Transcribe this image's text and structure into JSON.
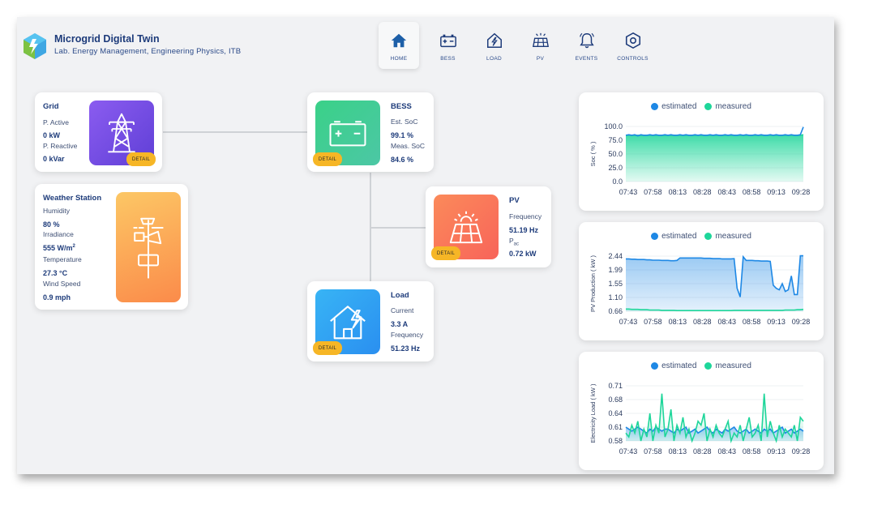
{
  "app": {
    "title": "Microgrid Digital Twin",
    "subtitle": "Lab. Energy Management, Engineering Physics, ITB"
  },
  "nav": [
    {
      "label": "HOME",
      "icon": "home-icon"
    },
    {
      "label": "BESS",
      "icon": "battery-icon"
    },
    {
      "label": "LOAD",
      "icon": "house-bolt-icon"
    },
    {
      "label": "PV",
      "icon": "solar-panel-icon"
    },
    {
      "label": "EVENTS",
      "icon": "bell-icon"
    },
    {
      "label": "CONTROLS",
      "icon": "hexagon-gear-icon"
    }
  ],
  "grid": {
    "title": "Grid",
    "p_active_label": "P. Active",
    "p_active_value": "0 kW",
    "p_reactive_label": "P. Reactive",
    "p_reactive_value": "0 kVar",
    "detail": "DETAIL"
  },
  "weather": {
    "title": "Weather Station",
    "humidity_label": "Humidity",
    "humidity_value": "80 %",
    "irradiance_label": "Irradiance",
    "irradiance_value": "555 W/m",
    "irradiance_sup": "2",
    "temperature_label": "Temperature",
    "temperature_value": "27.3 °C",
    "wind_label": "Wind Speed",
    "wind_value": "0.9 mph"
  },
  "bess": {
    "title": "BESS",
    "est_soc_label": "Est. SoC",
    "est_soc_value": "99.1 %",
    "meas_soc_label": "Meas. SoC",
    "meas_soc_value": "84.6 %",
    "detail": "DETAIL"
  },
  "pv": {
    "title": "PV",
    "freq_label": "Frequency",
    "freq_value": "51.19 Hz",
    "pac_label": "P",
    "pac_sub": "ac",
    "pac_value": "0.72 kW",
    "detail": "DETAIL"
  },
  "load": {
    "title": "Load",
    "current_label": "Current",
    "current_value": "3.3 A",
    "freq_label": "Frequency",
    "freq_value": "51.23 Hz",
    "detail": "DETAIL"
  },
  "colors": {
    "estimated": "#1e88e5",
    "measured": "#1ed69a",
    "detail": "#f6b626",
    "grid_tile": "#7a4be0",
    "weather_tile": "#fb9a52",
    "bess_tile": "#3ccf8e",
    "pv_tile": "#fa6f5a",
    "load_tile": "#2d9df0"
  },
  "chart_data": [
    {
      "type": "line",
      "legend": [
        "estimated",
        "measured"
      ],
      "ylabel": "Soc ( % )",
      "x_ticks": [
        "07:43",
        "07:58",
        "08:13",
        "08:28",
        "08:43",
        "08:58",
        "09:13",
        "09:28"
      ],
      "y_ticks": [
        "100.0",
        "75.0",
        "50.0",
        "25.0",
        "0.0"
      ],
      "ylim": [
        0,
        100
      ],
      "series": [
        {
          "name": "estimated",
          "values": [
            84,
            85,
            84,
            85,
            83,
            85,
            84,
            84,
            85,
            84,
            85,
            84,
            84,
            85,
            84,
            85,
            84,
            84,
            85,
            84,
            85,
            84,
            84,
            85,
            84,
            85,
            84,
            84,
            85,
            84,
            85,
            84,
            84,
            85,
            84,
            85,
            84,
            84,
            85,
            84,
            85,
            84,
            84,
            85,
            84,
            85,
            84,
            84,
            85,
            84,
            85,
            84,
            84,
            85,
            84,
            85,
            84,
            84,
            85,
            99
          ]
        },
        {
          "name": "measured",
          "values": [
            84,
            84,
            84,
            84,
            84,
            84,
            84,
            84,
            84,
            84,
            84,
            84,
            84,
            84,
            84,
            84,
            84,
            84,
            84,
            84,
            84,
            84,
            84,
            84,
            84,
            84,
            84,
            84,
            84,
            84,
            84,
            84,
            84,
            84,
            84,
            84,
            84,
            84,
            84,
            84,
            84,
            84,
            84,
            84,
            84,
            84,
            84,
            84,
            84,
            84,
            84,
            84,
            84,
            84,
            84,
            84,
            84,
            84,
            84,
            85
          ]
        }
      ]
    },
    {
      "type": "line",
      "legend": [
        "estimated",
        "measured"
      ],
      "ylabel": "PV Production ( kW )",
      "x_ticks": [
        "07:43",
        "07:58",
        "08:13",
        "08:28",
        "08:43",
        "08:58",
        "09:13",
        "09:28"
      ],
      "y_ticks": [
        "2.44",
        "1.99",
        "1.55",
        "1.10",
        "0.66"
      ],
      "ylim": [
        0.66,
        2.44
      ],
      "series": [
        {
          "name": "estimated",
          "values": [
            2.35,
            2.35,
            2.34,
            2.34,
            2.33,
            2.33,
            2.33,
            2.32,
            2.32,
            2.31,
            2.31,
            2.31,
            2.3,
            2.3,
            2.3,
            2.29,
            2.29,
            2.3,
            2.38,
            2.38,
            2.38,
            2.38,
            2.38,
            2.38,
            2.38,
            2.38,
            2.37,
            2.37,
            2.37,
            2.36,
            2.36,
            2.36,
            2.35,
            2.35,
            2.35,
            2.35,
            2.36,
            1.4,
            1.12,
            2.42,
            2.3,
            2.3,
            2.3,
            2.29,
            2.29,
            2.28,
            2.28,
            2.28,
            2.27,
            1.5,
            1.4,
            1.35,
            1.55,
            1.3,
            1.35,
            1.8,
            1.2,
            1.2,
            2.45,
            2.45
          ]
        },
        {
          "name": "measured",
          "values": [
            0.73,
            0.73,
            0.72,
            0.72,
            0.72,
            0.71,
            0.71,
            0.71,
            0.7,
            0.7,
            0.7,
            0.7,
            0.69,
            0.69,
            0.69,
            0.69,
            0.69,
            0.68,
            0.68,
            0.68,
            0.68,
            0.68,
            0.68,
            0.68,
            0.68,
            0.68,
            0.68,
            0.68,
            0.68,
            0.68,
            0.68,
            0.68,
            0.68,
            0.68,
            0.68,
            0.68,
            0.69,
            0.69,
            0.69,
            0.69,
            0.69,
            0.69,
            0.69,
            0.69,
            0.69,
            0.69,
            0.69,
            0.69,
            0.69,
            0.69,
            0.69,
            0.69,
            0.69,
            0.7,
            0.7,
            0.7,
            0.7,
            0.71,
            0.71,
            0.72
          ]
        }
      ]
    },
    {
      "type": "line",
      "legend": [
        "estimated",
        "measured"
      ],
      "ylabel": "Electricity Load ( kW )",
      "x_ticks": [
        "07:43",
        "07:58",
        "08:13",
        "08:28",
        "08:43",
        "08:58",
        "09:13",
        "09:28"
      ],
      "y_ticks": [
        "0.71",
        "0.68",
        "0.64",
        "0.61",
        "0.58"
      ],
      "ylim": [
        0.58,
        0.72
      ],
      "series": [
        {
          "name": "estimated",
          "values": [
            0.615,
            0.61,
            0.605,
            0.61,
            0.615,
            0.61,
            0.605,
            0.6,
            0.61,
            0.605,
            0.615,
            0.61,
            0.605,
            0.61,
            0.61,
            0.605,
            0.6,
            0.61,
            0.605,
            0.61,
            0.615,
            0.6,
            0.605,
            0.61,
            0.6,
            0.605,
            0.61,
            0.615,
            0.605,
            0.6,
            0.61,
            0.605,
            0.6,
            0.61,
            0.605,
            0.61,
            0.615,
            0.605,
            0.6,
            0.605,
            0.61,
            0.6,
            0.605,
            0.61,
            0.605,
            0.6,
            0.61,
            0.605,
            0.61,
            0.6,
            0.605,
            0.61,
            0.615,
            0.6,
            0.605,
            0.61,
            0.6,
            0.605,
            0.61,
            0.605
          ]
        },
        {
          "name": "measured",
          "values": [
            0.6,
            0.59,
            0.62,
            0.6,
            0.63,
            0.58,
            0.61,
            0.59,
            0.65,
            0.58,
            0.62,
            0.6,
            0.7,
            0.59,
            0.61,
            0.66,
            0.58,
            0.62,
            0.6,
            0.64,
            0.59,
            0.61,
            0.58,
            0.6,
            0.63,
            0.62,
            0.65,
            0.58,
            0.61,
            0.59,
            0.62,
            0.6,
            0.59,
            0.61,
            0.63,
            0.58,
            0.6,
            0.59,
            0.62,
            0.58,
            0.61,
            0.64,
            0.59,
            0.6,
            0.62,
            0.58,
            0.7,
            0.59,
            0.63,
            0.6,
            0.58,
            0.62,
            0.59,
            0.61,
            0.6,
            0.59,
            0.62,
            0.58,
            0.64,
            0.63
          ]
        }
      ]
    }
  ]
}
